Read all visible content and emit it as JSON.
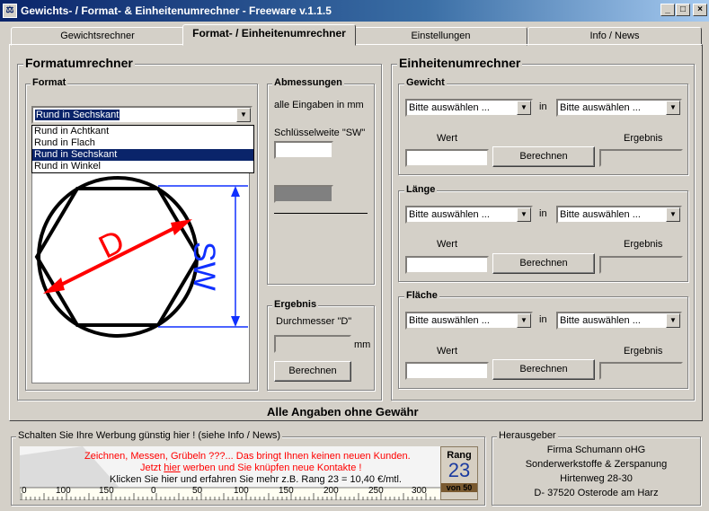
{
  "window": {
    "title": "Gewichts- / Format- & Einheitenumrechner - Freeware v.1.1.5",
    "min": "_",
    "max": "□",
    "close": "×"
  },
  "tabs": [
    {
      "label": "Gewichtsrechner"
    },
    {
      "label": "Format- / Einheitenumrechner"
    },
    {
      "label": "Einstellungen"
    },
    {
      "label": "Info / News"
    }
  ],
  "formatumrechner": {
    "title": "Formatumrechner",
    "format": {
      "label": "Format",
      "selected": "Rund in Sechskant",
      "options": [
        "Rund in Achtkant",
        "Rund in Flach",
        "Rund in Sechskant",
        "Rund in Winkel"
      ],
      "selected_index": 2,
      "diagram": {
        "d": "D",
        "sw": "SW"
      }
    },
    "abmessungen": {
      "label": "Abmessungen",
      "hint": "alle Eingaben in mm",
      "sw_label": "Schlüsselweite \"SW\"",
      "sw_value": ""
    },
    "ergebnis": {
      "label": "Ergebnis",
      "result_label": "Durchmesser \"D\"",
      "unit": "mm",
      "button": "Berechnen"
    }
  },
  "einheitenumrechner": {
    "title": "Einheitenumrechner",
    "sections": [
      {
        "label": "Gewicht",
        "from": "Bitte auswählen ...",
        "in": "in",
        "to": "Bitte auswählen ...",
        "wert": "Wert",
        "ergebnis": "Ergebnis",
        "button": "Berechnen"
      },
      {
        "label": "Länge",
        "from": "Bitte auswählen ...",
        "in": "in",
        "to": "Bitte auswählen ...",
        "wert": "Wert",
        "ergebnis": "Ergebnis",
        "button": "Berechnen"
      },
      {
        "label": "Fläche",
        "from": "Bitte auswählen ...",
        "in": "in",
        "to": "Bitte auswählen ...",
        "wert": "Wert",
        "ergebnis": "Ergebnis",
        "button": "Berechnen"
      }
    ]
  },
  "disclaimer": "Alle Angaben ohne Gewähr",
  "werbung": {
    "label": "Schalten Sie Ihre Werbung günstig hier ! (siehe Info / News)",
    "line1": "Zeichnen, Messen, Grübeln ???... Das bringt Ihnen keinen neuen Kunden.",
    "line2_pre": "Jetzt ",
    "line2_link": "hier",
    "line2_post": " werben und Sie knüpfen neue Kontakte !",
    "line3": "Klicken Sie hier und erfahren Sie mehr  z.B. Rang 23 = 10,40 €/mtl.",
    "ruler_ticks": [
      "0",
      "100",
      "150",
      "0",
      "50",
      "100",
      "150",
      "200",
      "250",
      "300"
    ],
    "rang_label": "Rang",
    "rang_value": "23",
    "rang_of": "von 50"
  },
  "herausgeber": {
    "label": "Herausgeber",
    "lines": [
      "Firma Schumann oHG",
      "Sonderwerkstoffe & Zerspanung",
      "Hirtenweg 28-30",
      "D- 37520 Osterode am Harz"
    ]
  }
}
